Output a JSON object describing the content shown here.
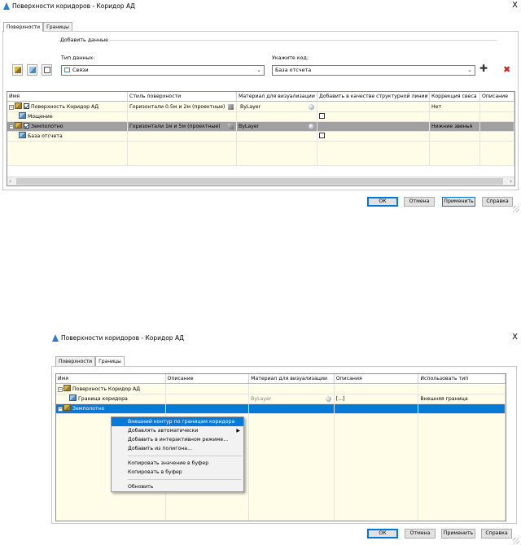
{
  "dialog1": {
    "title": "Поверхности коридоров - Коридор АД",
    "close_glyph": "X",
    "tabs": [
      "Поверхности",
      "Границы"
    ],
    "add_data_group": "Добавить данные",
    "data_type_label": "Тип данных:",
    "data_type_value": "Связи",
    "code_label": "Укажите код:",
    "code_value": "База отсчета",
    "columns": [
      "Имя",
      "Стиль поверхности",
      "Материал для визуализации",
      "Добавить в качестве структурной линии",
      "Коррекция свеса",
      "Описание"
    ],
    "rows": [
      {
        "name": "Поверхность Коридор АД",
        "style": "Горизонтали 0.5м и 2м (проектные)",
        "material": "ByLayer",
        "structural": "",
        "overhang": "Нет",
        "desc": ""
      },
      {
        "name": "Мощение",
        "style": "",
        "material": "",
        "structural": "",
        "overhang": "",
        "desc": ""
      },
      {
        "name": "Земполотно",
        "style": "Горизонтали 1м и 5м (проектные)",
        "material": "ByLayer",
        "structural": "",
        "overhang": "Нижние звенья",
        "desc": ""
      },
      {
        "name": "База отсчета",
        "style": "",
        "material": "",
        "structural": "",
        "overhang": "",
        "desc": ""
      }
    ],
    "buttons": {
      "ok": "ОК",
      "cancel": "Отмена",
      "apply": "Применить",
      "help": "Справка"
    }
  },
  "dialog2": {
    "title": "Поверхности коридоров - Коридор АД",
    "close_glyph": "X",
    "tabs": [
      "Поверхности",
      "Границы"
    ],
    "columns": [
      "Имя",
      "Описание",
      "Материал для визуализации",
      "Описания",
      "Использовать тип"
    ],
    "rows": [
      {
        "name": "Поверхность Коридор АД",
        "desc": "",
        "material": "",
        "descs": "",
        "type": ""
      },
      {
        "name": "Граница коридора",
        "desc": "",
        "material": "ByLayer",
        "descs": "[...]",
        "type": "Внешняя граница"
      },
      {
        "name": "Земполотно",
        "desc": "",
        "material": "",
        "descs": "",
        "type": ""
      }
    ],
    "context_menu": [
      "Внешний контур по границам коридора",
      "Добавлять автоматически",
      "Добавить в интерактивном режиме...",
      "Добавить из полигона...",
      "Копировать значение в буфер",
      "Копировать в буфер",
      "Обновить"
    ],
    "submenu_glyph": "▶",
    "buttons": {
      "ok": "ОК",
      "cancel": "Отмена",
      "apply": "Применить",
      "help": "Справка"
    }
  },
  "colors": {
    "selection": "#0a78d7",
    "row_grey": "#a0a0a0",
    "row_yellow": "#fffde8",
    "delete_red": "#d02020"
  }
}
